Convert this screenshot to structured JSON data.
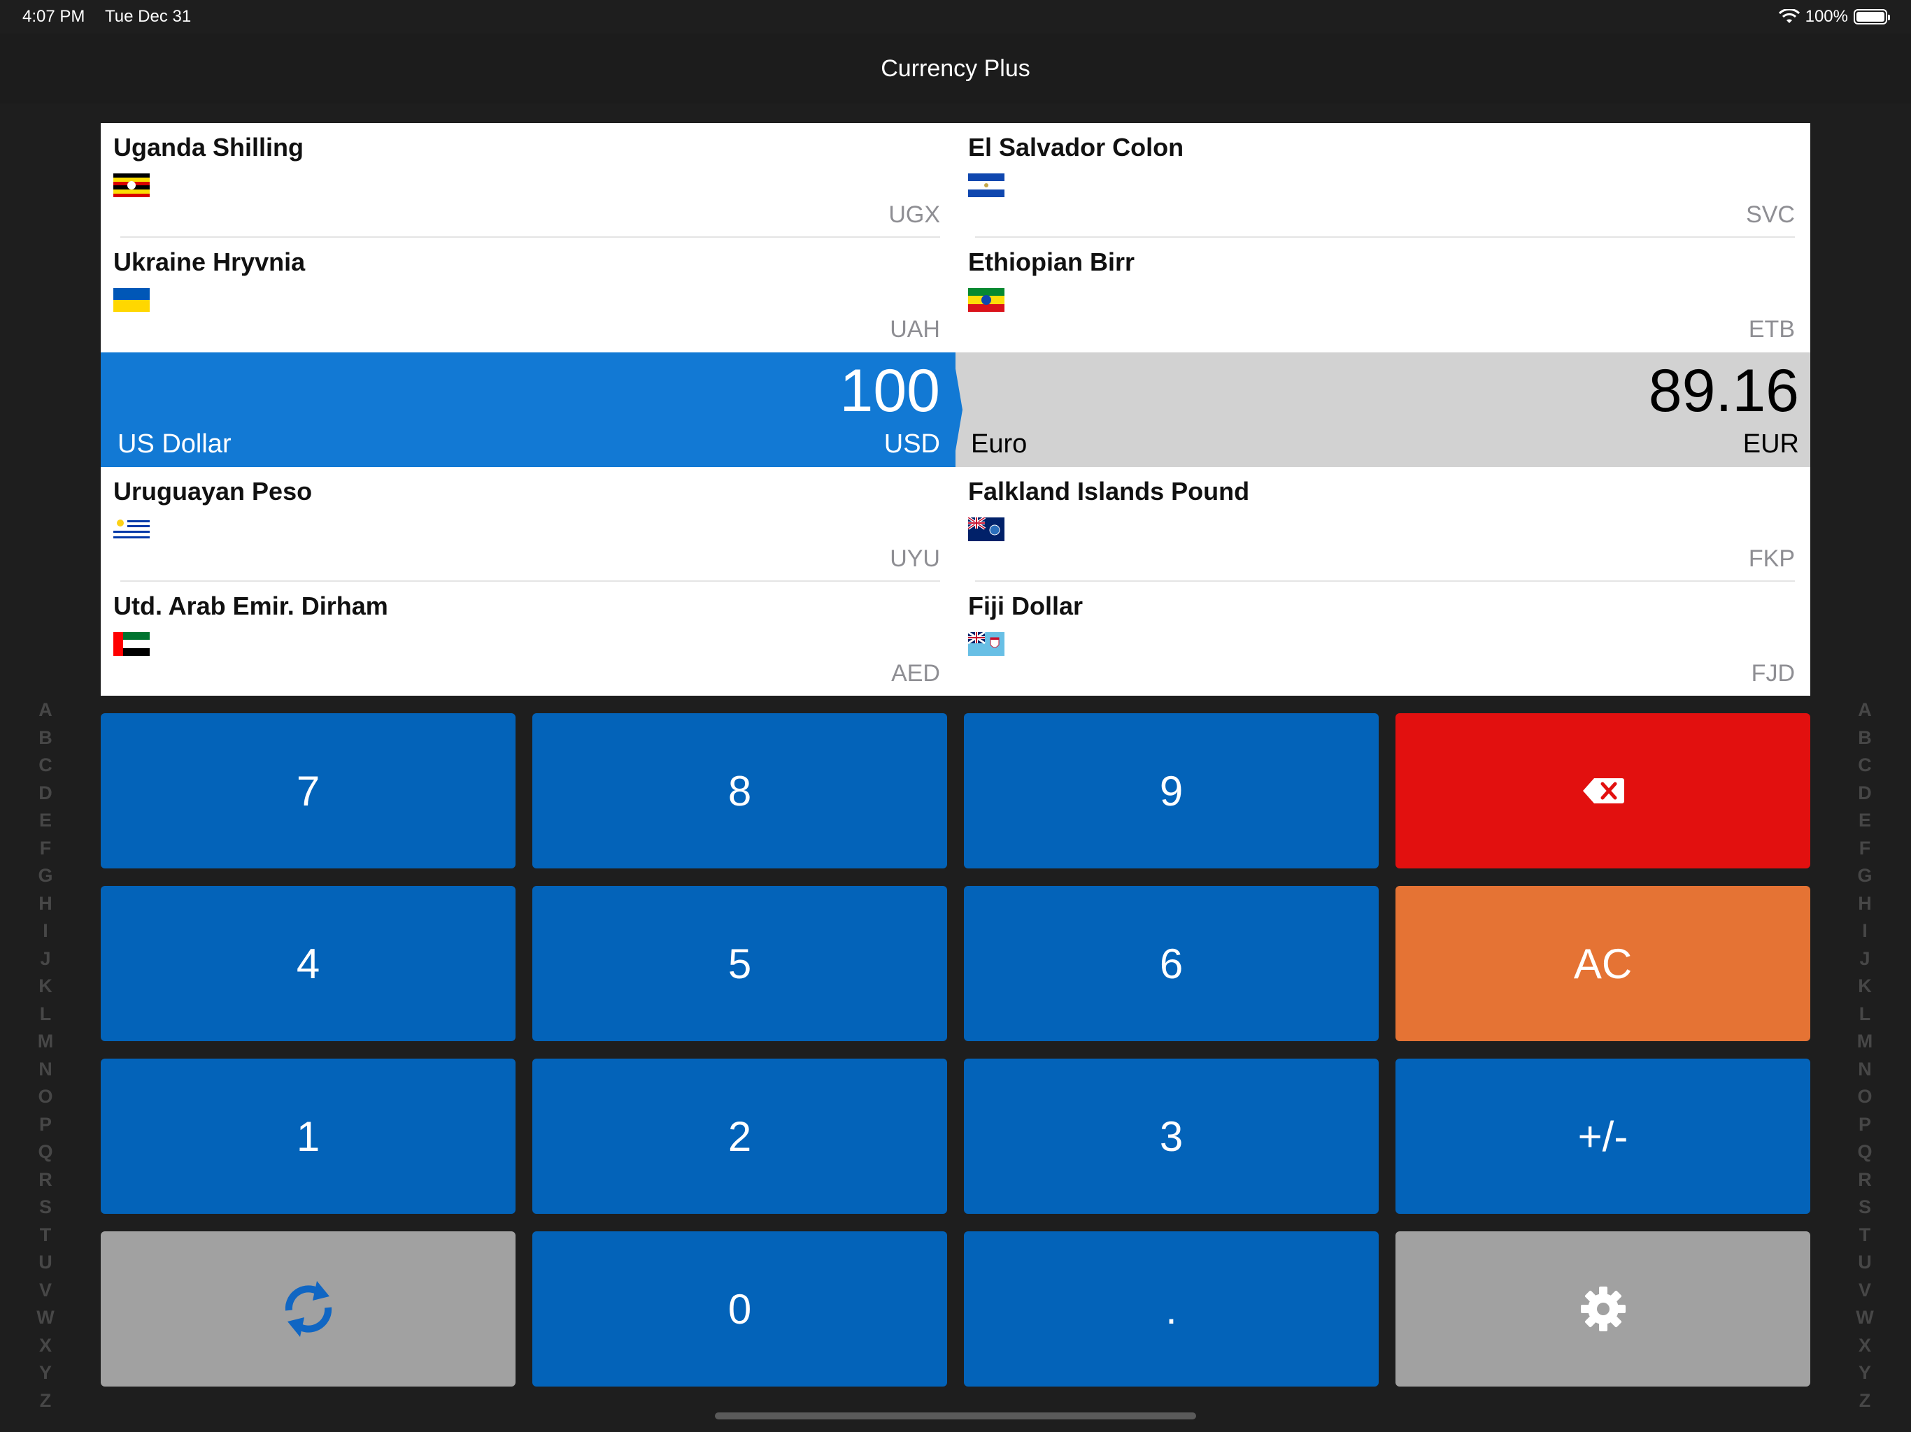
{
  "status_bar": {
    "time": "4:07 PM",
    "date": "Tue Dec 31",
    "battery": "100%"
  },
  "nav": {
    "title": "Currency Plus"
  },
  "alphabet": [
    "A",
    "B",
    "C",
    "D",
    "E",
    "F",
    "G",
    "H",
    "I",
    "J",
    "K",
    "L",
    "M",
    "N",
    "O",
    "P",
    "Q",
    "R",
    "S",
    "T",
    "U",
    "V",
    "W",
    "X",
    "Y",
    "Z"
  ],
  "left_currencies": [
    {
      "name": "Uganda Shilling",
      "code": "UGX",
      "flag": "uganda-flag"
    },
    {
      "name": "Ukraine Hryvnia",
      "code": "UAH",
      "flag": "ukraine-flag"
    },
    {
      "name": "Uruguayan Peso",
      "code": "UYU",
      "flag": "uruguay-flag"
    },
    {
      "name": "Utd. Arab Emir. Dirham",
      "code": "AED",
      "flag": "uae-flag"
    }
  ],
  "right_currencies": [
    {
      "name": "El Salvador Colon",
      "code": "SVC",
      "flag": "el-salvador-flag"
    },
    {
      "name": "Ethiopian Birr",
      "code": "ETB",
      "flag": "ethiopia-flag"
    },
    {
      "name": "Falkland Islands Pound",
      "code": "FKP",
      "flag": "falkland-flag"
    },
    {
      "name": "Fiji Dollar",
      "code": "FJD",
      "flag": "fiji-flag"
    }
  ],
  "selected_from": {
    "name": "US Dollar",
    "code": "USD",
    "amount": "100",
    "color": "#1279d4"
  },
  "selected_to": {
    "name": "Euro",
    "code": "EUR",
    "amount": "89.16",
    "color": "#d2d2d2"
  },
  "keypad": {
    "k7": "7",
    "k8": "8",
    "k9": "9",
    "backspace": "backspace-icon",
    "k4": "4",
    "k5": "5",
    "k6": "6",
    "clear": "AC",
    "k1": "1",
    "k2": "2",
    "k3": "3",
    "sign": "+/-",
    "swap": "swap-icon",
    "k0": "0",
    "decimal": ".",
    "settings": "gear-icon"
  },
  "colors": {
    "key_blue": "#0363b9",
    "key_red": "#e2100f",
    "key_orange": "#e57334",
    "key_gray": "#a1a1a1"
  }
}
